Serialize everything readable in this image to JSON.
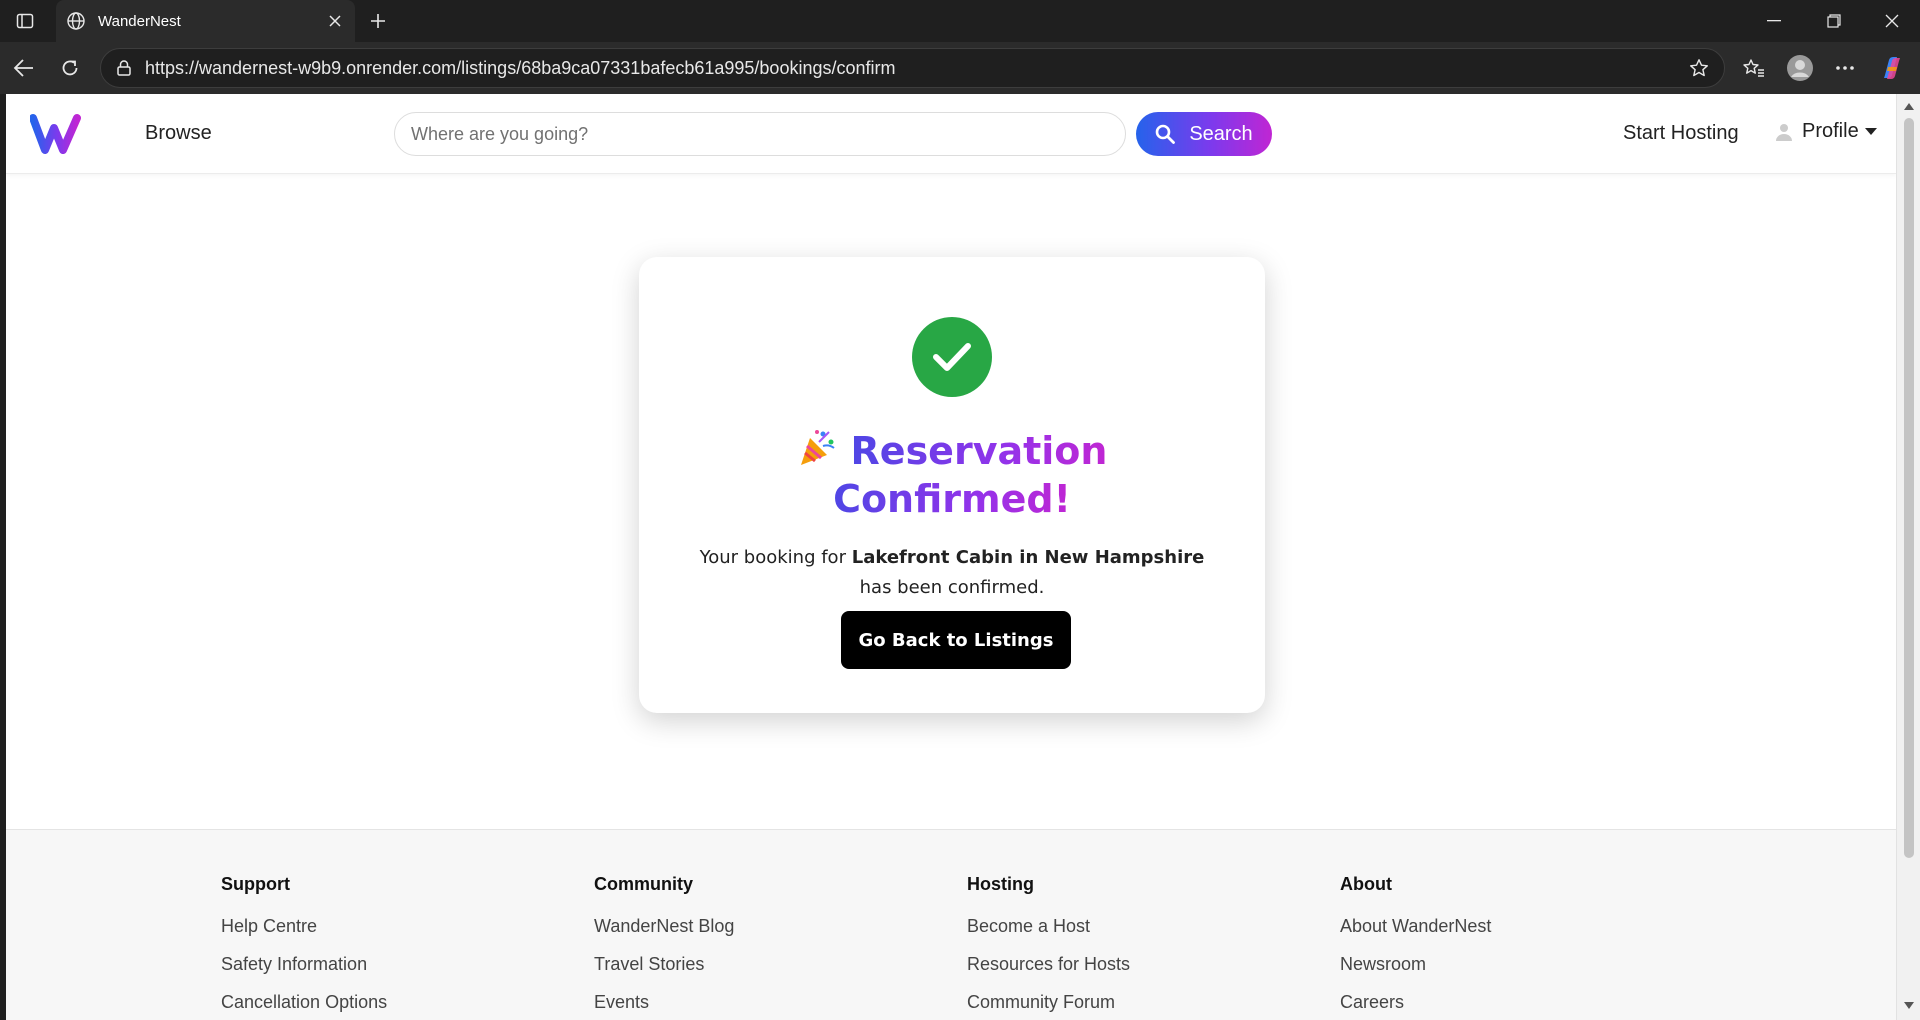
{
  "browser": {
    "tab_title": "WanderNest",
    "url": "https://wandernest-w9b9.onrender.com/listings/68ba9ca07331bafecb61a995/bookings/confirm"
  },
  "header": {
    "browse_label": "Browse",
    "search_placeholder": "Where are you going?",
    "search_button": "Search",
    "start_hosting": "Start Hosting",
    "profile_label": "Profile"
  },
  "confirmation": {
    "title_line1": "Reservation",
    "title_line2": "Confirmed!",
    "message_prefix": "Your booking for",
    "listing_name": "Lakefront Cabin in New Hampshire",
    "message_suffix": "has been confirmed.",
    "back_button": "Go Back to Listings"
  },
  "footer": {
    "columns": [
      {
        "heading": "Support",
        "links": [
          "Help Centre",
          "Safety Information",
          "Cancellation Options"
        ]
      },
      {
        "heading": "Community",
        "links": [
          "WanderNest Blog",
          "Travel Stories",
          "Events"
        ]
      },
      {
        "heading": "Hosting",
        "links": [
          "Become a Host",
          "Resources for Hosts",
          "Community Forum"
        ]
      },
      {
        "heading": "About",
        "links": [
          "About WanderNest",
          "Newsroom",
          "Careers"
        ]
      }
    ]
  },
  "colors": {
    "brand_gradient_start": "#2563eb",
    "brand_gradient_end": "#c026d3",
    "success_green": "#28a745"
  }
}
